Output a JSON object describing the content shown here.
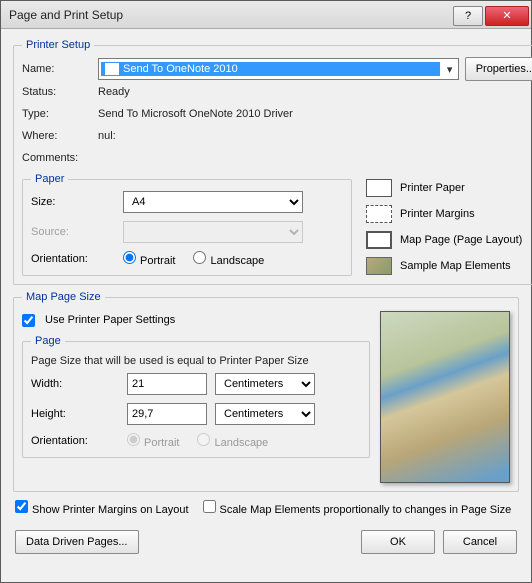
{
  "window": {
    "title": "Page and Print Setup"
  },
  "printerSetup": {
    "legend": "Printer Setup",
    "nameLabel": "Name:",
    "nameValue": "Send To OneNote 2010",
    "propertiesBtn": "Properties...",
    "statusLabel": "Status:",
    "statusValue": "Ready",
    "typeLabel": "Type:",
    "typeValue": "Send To Microsoft OneNote 2010 Driver",
    "whereLabel": "Where:",
    "whereValue": "nul:",
    "commentsLabel": "Comments:"
  },
  "paper": {
    "legend": "Paper",
    "sizeLabel": "Size:",
    "sizeValue": "A4",
    "sourceLabel": "Source:",
    "sourceValue": "",
    "orientationLabel": "Orientation:",
    "portraitLabel": "Portrait",
    "landscapeLabel": "Landscape",
    "orientation": "portrait"
  },
  "legendPane": {
    "printerPaper": "Printer Paper",
    "printerMargins": "Printer Margins",
    "mapPage": "Map Page (Page Layout)",
    "sample": "Sample Map Elements"
  },
  "mapPageSize": {
    "legend": "Map Page Size",
    "usePrinterLabel": "Use Printer Paper Settings",
    "usePrinterChecked": true,
    "pageLegend": "Page",
    "note": "Page Size that will be used is equal to Printer Paper Size",
    "widthLabel": "Width:",
    "widthValue": "21",
    "widthUnit": "Centimeters",
    "heightLabel": "Height:",
    "heightValue": "29,7",
    "heightUnit": "Centimeters",
    "orientationLabel": "Orientation:",
    "portraitLabel": "Portrait",
    "landscapeLabel": "Landscape"
  },
  "options": {
    "showMarginsLabel": "Show Printer Margins on Layout",
    "showMarginsChecked": true,
    "scaleLabel": "Scale Map Elements proportionally to changes in Page Size",
    "scaleChecked": false
  },
  "footer": {
    "dataDriven": "Data Driven Pages...",
    "ok": "OK",
    "cancel": "Cancel"
  }
}
